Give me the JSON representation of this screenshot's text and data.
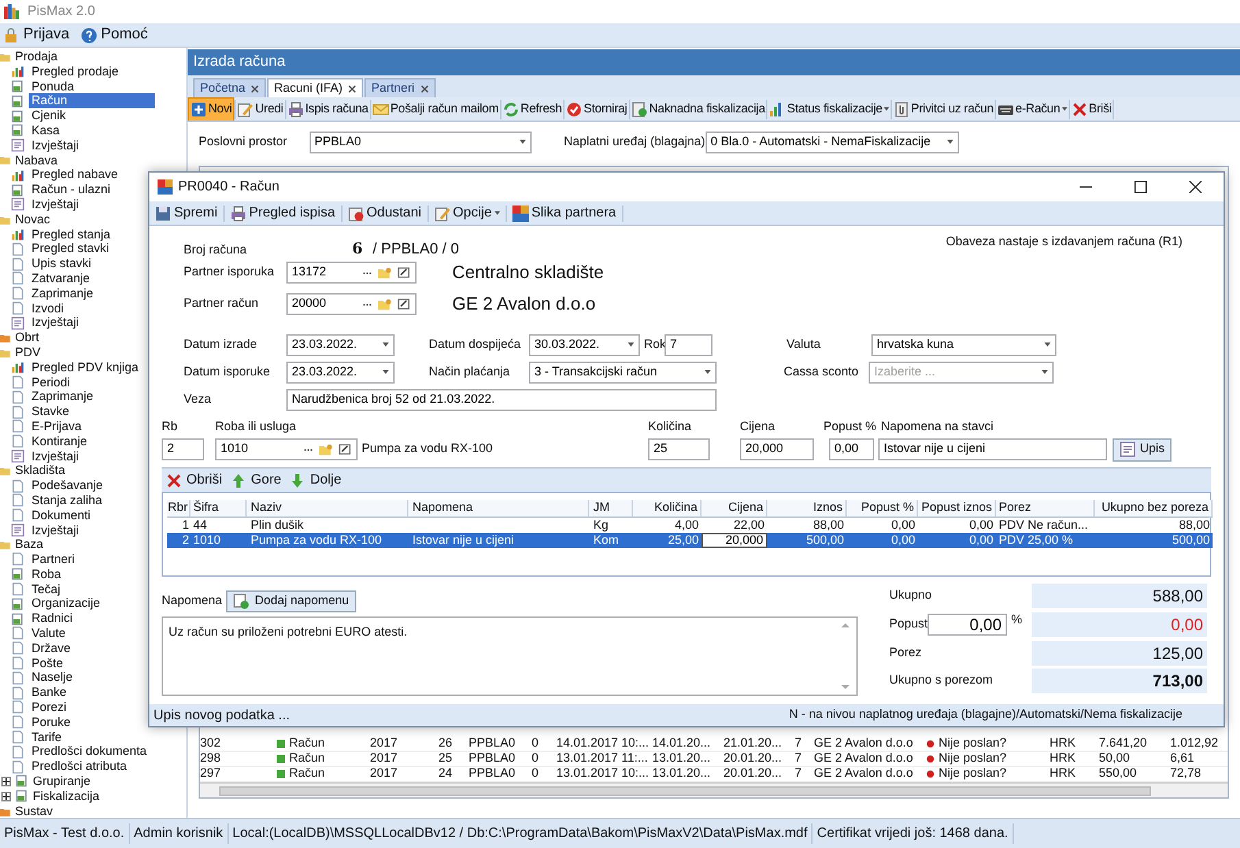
{
  "app": {
    "title": "PisMax 2.0"
  },
  "menu": [
    {
      "label": "Prijava"
    },
    {
      "label": "Pomoć"
    }
  ],
  "sidebar": {
    "items": [
      {
        "label": "Prodaja",
        "kind": "folder",
        "children": [
          {
            "label": "Pregled prodaje",
            "kind": "overview",
            "selected": false
          },
          {
            "label": "Ponuda",
            "kind": "form",
            "selected": false
          },
          {
            "label": "Račun",
            "kind": "form",
            "selected": true
          },
          {
            "label": "Cjenik",
            "kind": "form",
            "selected": false
          },
          {
            "label": "Kasa",
            "kind": "form",
            "selected": false
          },
          {
            "label": "Izvještaji",
            "kind": "report",
            "selected": false
          }
        ]
      },
      {
        "label": "Nabava",
        "kind": "folder",
        "children": [
          {
            "label": "Pregled nabave",
            "kind": "overview",
            "selected": false
          },
          {
            "label": "Račun - ulazni",
            "kind": "form",
            "selected": false
          },
          {
            "label": "Izvještaji",
            "kind": "report",
            "selected": false
          }
        ]
      },
      {
        "label": "Novac",
        "kind": "folder",
        "children": [
          {
            "label": "Pregled stanja",
            "kind": "overview",
            "selected": false
          },
          {
            "label": "Pregled stavki",
            "kind": "page",
            "selected": false
          },
          {
            "label": "Upis stavki",
            "kind": "page",
            "selected": false
          },
          {
            "label": "Zatvaranje",
            "kind": "page",
            "selected": false
          },
          {
            "label": "Zaprimanje",
            "kind": "page",
            "selected": false
          },
          {
            "label": "Izvodi",
            "kind": "page",
            "selected": false
          },
          {
            "label": "Izvještaji",
            "kind": "report",
            "selected": false
          }
        ]
      },
      {
        "label": "Obrt",
        "kind": "section"
      },
      {
        "label": "PDV",
        "kind": "folder",
        "children": [
          {
            "label": "Pregled PDV knjiga",
            "kind": "overview",
            "selected": false
          },
          {
            "label": "Periodi",
            "kind": "page",
            "selected": false
          },
          {
            "label": "Zaprimanje",
            "kind": "page",
            "selected": false
          },
          {
            "label": "Stavke",
            "kind": "page",
            "selected": false
          },
          {
            "label": "E-Prijava",
            "kind": "page",
            "selected": false
          },
          {
            "label": "Kontiranje",
            "kind": "page",
            "selected": false
          },
          {
            "label": "Izvještaji",
            "kind": "report",
            "selected": false
          }
        ]
      },
      {
        "label": "Skladišta",
        "kind": "folder",
        "children": [
          {
            "label": "Podešavanje",
            "kind": "page",
            "selected": false
          },
          {
            "label": "Stanja zaliha",
            "kind": "page",
            "selected": false
          },
          {
            "label": "Dokumenti",
            "kind": "page",
            "selected": false
          },
          {
            "label": "Izvještaji",
            "kind": "report",
            "selected": false
          }
        ]
      },
      {
        "label": "Baza",
        "kind": "folder",
        "children": [
          {
            "label": "Partneri",
            "kind": "page",
            "selected": false
          },
          {
            "label": "Roba",
            "kind": "form",
            "selected": false
          },
          {
            "label": "Tečaj",
            "kind": "page",
            "selected": false
          },
          {
            "label": "Organizacije",
            "kind": "form",
            "selected": false
          },
          {
            "label": "Radnici",
            "kind": "form",
            "selected": false
          },
          {
            "label": "Valute",
            "kind": "page",
            "selected": false
          },
          {
            "label": "Države",
            "kind": "page",
            "selected": false
          },
          {
            "label": "Pošte",
            "kind": "page",
            "selected": false
          },
          {
            "label": "Naselje",
            "kind": "page",
            "selected": false
          },
          {
            "label": "Banke",
            "kind": "page",
            "selected": false
          },
          {
            "label": "Porezi",
            "kind": "page",
            "selected": false
          },
          {
            "label": "Poruke",
            "kind": "page",
            "selected": false
          },
          {
            "label": "Tarife",
            "kind": "page",
            "selected": false
          },
          {
            "label": "Predlošci dokumenta",
            "kind": "page",
            "selected": false
          },
          {
            "label": "Predlošci atributa",
            "kind": "page",
            "selected": false
          }
        ]
      },
      {
        "label": "Grupiranje",
        "kind": "module",
        "expanded": false
      },
      {
        "label": "Fiskalizacija",
        "kind": "module",
        "expanded": false
      },
      {
        "label": "Sustav",
        "kind": "section"
      }
    ]
  },
  "page": {
    "title": "Izrada računa",
    "tabs": [
      {
        "label": "Početna",
        "selected": false
      },
      {
        "label": "Racuni (IFA)",
        "selected": true
      },
      {
        "label": "Partneri",
        "selected": false
      }
    ],
    "toolbar": [
      {
        "label": "Novi",
        "highlighted": true,
        "dropdown": false
      },
      {
        "label": "Uredi",
        "highlighted": false,
        "dropdown": false
      },
      {
        "label": "Ispis računa",
        "highlighted": false,
        "dropdown": false
      },
      {
        "label": "Pošalji račun mailom",
        "highlighted": false,
        "dropdown": false
      },
      {
        "label": "Refresh",
        "highlighted": false,
        "dropdown": false
      },
      {
        "label": "Storniraj",
        "highlighted": false,
        "dropdown": false
      },
      {
        "label": "Naknadna fiskalizacija",
        "highlighted": false,
        "dropdown": false
      },
      {
        "label": "Status fiskalizacije",
        "highlighted": false,
        "dropdown": true
      },
      {
        "label": "Privitci uz račun",
        "highlighted": false,
        "dropdown": false
      },
      {
        "label": "e-Račun",
        "highlighted": false,
        "dropdown": true
      },
      {
        "label": "Briši",
        "highlighted": false,
        "dropdown": false
      }
    ],
    "filters": [
      {
        "label": "Poslovni prostor",
        "value": "PPBLA0"
      },
      {
        "label": "Naplatni uređaj (blagajna)",
        "value": "0 Bla.0 - Automatski - NemaFiskalizacije"
      }
    ],
    "grid": {
      "rows": [
        {
          "cells": [
            "302",
            "Račun",
            "2017",
            "26",
            "PPBLA0",
            "0",
            "14.01.2017 10:...",
            "14.01.20...",
            "21.01.20...",
            "7",
            "GE 2 Avalon d.o.o",
            "Nije poslan?",
            "HRK",
            "7.641,20",
            "1.012,92"
          ]
        },
        {
          "cells": [
            "298",
            "Račun",
            "2017",
            "25",
            "PPBLA0",
            "0",
            "13.01.2017 11:...",
            "13.01.20...",
            "20.01.20...",
            "7",
            "GE 2 Avalon d.o.o",
            "Nije poslan?",
            "HRK",
            "50,00",
            "6,61"
          ]
        },
        {
          "cells": [
            "297",
            "Račun",
            "2017",
            "24",
            "PPBLA0",
            "0",
            "13.01.2017 10:...",
            "13.01.20...",
            "20.01.20...",
            "7",
            "GE 2 Avalon d.o.o",
            "Nije poslan?",
            "HRK",
            "550,00",
            "72,78"
          ]
        }
      ]
    }
  },
  "dialog": {
    "title": "PR0040 - Račun",
    "toolbar": [
      {
        "label": "Spremi",
        "dropdown": false
      },
      {
        "label": "Pregled ispisa",
        "dropdown": false
      },
      {
        "label": "Odustani",
        "dropdown": false
      },
      {
        "label": "Opcije",
        "dropdown": true
      },
      {
        "label": "Slika partnera",
        "dropdown": false
      }
    ],
    "invoice_number": {
      "label": "Broj računa",
      "number": "6",
      "suffix": "/ PPBLA0 / 0"
    },
    "obligation_note": "Obaveza nastaje s izdavanjem računa (R1)",
    "partners": [
      {
        "label": "Partner isporuka",
        "value": "13172",
        "name": "Centralno skladište"
      },
      {
        "label": "Partner račun",
        "value": "20000",
        "name": "GE 2 Avalon d.o.o"
      }
    ],
    "issue_date": {
      "label": "Datum izrade",
      "value": "23.03.2022."
    },
    "due_date": {
      "label": "Datum dospijeća",
      "value": "30.03.2022."
    },
    "term": {
      "label": "Rok",
      "value": "7"
    },
    "currency": {
      "label": "Valuta",
      "value": "hrvatska kuna"
    },
    "delivery_date": {
      "label": "Datum isporuke",
      "value": "23.03.2022."
    },
    "payment_method": {
      "label": "Način plaćanja",
      "value": "3 - Transakcijski račun"
    },
    "cassa_sconto": {
      "label": "Cassa sconto",
      "placeholder": "Izaberite ..."
    },
    "reference": {
      "label": "Veza",
      "value": "Narudžbenica broj 52 od 21.03.2022."
    },
    "item_entry": {
      "rb": {
        "label": "Rb",
        "value": "2"
      },
      "item": {
        "label": "Roba ili usluga",
        "value": "1010",
        "name": "Pumpa za vodu RX-100"
      },
      "quantity": {
        "label": "Količina",
        "value": "25"
      },
      "price": {
        "label": "Cijena",
        "value": "20,000"
      },
      "discount": {
        "label": "Popust %",
        "value": "0,00"
      },
      "note": {
        "label": "Napomena na stavci",
        "value": "Istovar nije u cijeni"
      },
      "button": "Upis"
    },
    "grid_toolbar": [
      "Obriši",
      "Gore",
      "Dolje"
    ],
    "items": {
      "columns": [
        "Rbr",
        "Šifra",
        "Naziv",
        "Napomena",
        "JM",
        "Količina",
        "Cijena",
        "Iznos",
        "Popust %",
        "Popust iznos",
        "Porez",
        "Ukupno bez poreza"
      ],
      "rows": [
        {
          "selected": false,
          "cells": [
            "1",
            "44",
            "Plin dušik",
            "",
            "Kg",
            "4,00",
            "22,00",
            "88,00",
            "0,00",
            "0,00",
            "PDV  Ne račun...",
            "88,00"
          ]
        },
        {
          "selected": true,
          "cells": [
            "2",
            "1010",
            "Pumpa za vodu RX-100",
            "Istovar nije u cijeni",
            "Kom",
            "25,00",
            {
              "text": "20,000",
              "editing": true
            },
            "500,00",
            "0,00",
            "0,00",
            "PDV 25,00 %",
            "500,00"
          ]
        }
      ]
    },
    "note": {
      "label": "Napomena",
      "button": "Dodaj napomenu",
      "value": "Uz račun su priloženi potrebni EURO atesti."
    },
    "totals": {
      "subtotal": {
        "label": "Ukupno",
        "value": "588,00"
      },
      "discount": {
        "label": "Popust",
        "percent": "0,00",
        "unit": "%",
        "value": "0,00"
      },
      "tax": {
        "label": "Porez",
        "value": "125,00"
      },
      "total": {
        "label": "Ukupno s porezom",
        "value": "713,00"
      }
    },
    "status_left": "Upis novog podatka ...",
    "status_right": "N - na nivou naplatnog uređaja (blagajne)/Automatski/Nema fiskalizacije"
  },
  "status_bar": [
    "PisMax - Test d.o.o.",
    "Admin korisnik",
    "Local:(LocalDB)\\MSSQLLocalDBv12 / Db:C:\\ProgramData\\Bakom\\PisMaxV2\\Data\\PisMax.mdf",
    "Certifikat vrijedi još: 1468 dana."
  ]
}
